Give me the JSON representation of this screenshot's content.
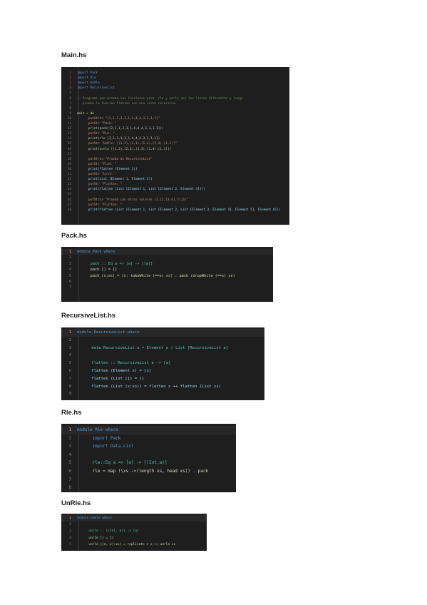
{
  "files": [
    {
      "label": "Main.hs",
      "lines": [
        {
          "n": "1",
          "t": "import Pack",
          "c": "kw"
        },
        {
          "n": "2",
          "t": "import Rle",
          "c": "kw"
        },
        {
          "n": "3",
          "t": "import UnRle",
          "c": "kw"
        },
        {
          "n": "4",
          "t": "import RecursiveList",
          "c": "kw"
        },
        {
          "n": "5",
          "t": "",
          "c": ""
        },
        {
          "n": "6",
          "t": "-- Programa que prueba los funciones pack, rle y unrle con los listas diferentes y luego",
          "c": "cm"
        },
        {
          "n": "7",
          "t": "   prueba la funcion flatten con una lista recursiva.",
          "c": "cm"
        },
        {
          "n": "8",
          "t": "",
          "c": ""
        },
        {
          "n": "9",
          "t": "main = do",
          "c": "fn"
        },
        {
          "n": "10",
          "t": "      putStrLn \"[2,1,1,3,3,1,4,4,4,3,3,1,1]\"",
          "c": "st"
        },
        {
          "n": "11",
          "t": "      putStr \"Pack: \"",
          "c": "st"
        },
        {
          "n": "12",
          "t": "      print(pack([2,1,1,3,3,1,4,4,4,3,3,1,1]))",
          "c": "nu"
        },
        {
          "n": "13",
          "t": "      putStr \"Rle: \"",
          "c": "st"
        },
        {
          "n": "14",
          "t": "      print(rle [2,1,1,3,3,1,4,4,4,3,3,1,1])",
          "c": "nu"
        },
        {
          "n": "15",
          "t": "      putStr \"UnRle: [(1,2),(2,1),(1,3),(2,4),(1,1)]\"",
          "c": "st"
        },
        {
          "n": "16",
          "t": "      print(unrle [(1,2),(2,1),(1,3),(2,4),(1,1)])",
          "c": "nu"
        },
        {
          "n": "17",
          "t": "",
          "c": ""
        },
        {
          "n": "18",
          "t": "      putStrLn \"Prueba de RecursiveList\"",
          "c": "st"
        },
        {
          "n": "19",
          "t": "      putStr \"Flat: \"",
          "c": "st"
        },
        {
          "n": "20",
          "t": "      print(flatten (Element 1))",
          "c": "vr"
        },
        {
          "n": "21",
          "t": "      putStr \"List: \"",
          "c": "st"
        },
        {
          "n": "22",
          "t": "      print(List [Element 1, Element 2])",
          "c": "vr"
        },
        {
          "n": "23",
          "t": "      putStr \"Flatten: \"",
          "c": "st"
        },
        {
          "n": "24",
          "t": "      print(flatten (List [Element 1, List [Element 2, Element 3]]))",
          "c": "vr"
        },
        {
          "n": "25",
          "t": "",
          "c": ""
        },
        {
          "n": "26",
          "t": "      putStrLn \"Prueba con otros valores [1,[2,[3,4],5],6]\"",
          "c": "st"
        },
        {
          "n": "27",
          "t": "      putStr \"Flatten: \"",
          "c": "st"
        },
        {
          "n": "28",
          "t": "      print(flatten (List [Element 1, List [Element 2, List [Element 3, Element 4], Element 5], Element 6]))",
          "c": "vr"
        }
      ]
    },
    {
      "label": "Pack.hs",
      "lines": [
        {
          "n": "1",
          "t": "module Pack where",
          "c": "kw"
        },
        {
          "n": "2",
          "t": "",
          "c": ""
        },
        {
          "n": "3",
          "t": "      pack :: Eq a => [a] -> [[a]]",
          "c": "ty"
        },
        {
          "n": "4",
          "t": "      pack [] = []",
          "c": "op"
        },
        {
          "n": "5",
          "t": "      pack (x:xs) = (x: takeWhile (==x) xs) : pack (dropWhile (==x) xs)",
          "c": "fn"
        },
        {
          "n": "6",
          "t": "",
          "c": ""
        },
        {
          "n": "7",
          "t": "",
          "c": ""
        }
      ]
    },
    {
      "label": "RecursiveList.hs",
      "lines": [
        {
          "n": "1",
          "t": "module RecursiveList where",
          "c": "kw"
        },
        {
          "n": "2",
          "t": "",
          "c": ""
        },
        {
          "n": "3",
          "t": "      data RecursiveList a = Element a | List [RecursiveList a]",
          "c": "ty"
        },
        {
          "n": "4",
          "t": "",
          "c": ""
        },
        {
          "n": "5",
          "t": "      flatten :: RecursiveList a -> [a]",
          "c": "ty"
        },
        {
          "n": "6",
          "t": "      flatten (Element x) = [x]",
          "c": "vr"
        },
        {
          "n": "7",
          "t": "      flatten (List []) = []",
          "c": "vr"
        },
        {
          "n": "8",
          "t": "      flatten (List (x:xs)) = flatten x ++ flatten (List xs)",
          "c": "vr"
        },
        {
          "n": "9",
          "t": "",
          "c": ""
        }
      ]
    },
    {
      "label": "Rle.hs",
      "lines": [
        {
          "n": "1",
          "t": "module Rle where",
          "c": "kw"
        },
        {
          "n": "2",
          "t": "      import Pack",
          "c": "kw"
        },
        {
          "n": "3",
          "t": "      import Data.List",
          "c": "kw"
        },
        {
          "n": "4",
          "t": "",
          "c": ""
        },
        {
          "n": "5",
          "t": "      rle::Eq a => [a] -> [(Int,a)]",
          "c": "ty"
        },
        {
          "n": "6",
          "t": "      rle = map (\\xs ->(length xs, head xs)) . pack",
          "c": "fn"
        },
        {
          "n": "7",
          "t": "",
          "c": ""
        },
        {
          "n": "8",
          "t": "",
          "c": ""
        }
      ]
    },
    {
      "label": "UnRle.hs",
      "lines": [
        {
          "n": "1",
          "t": "module UnRle where",
          "c": "kw"
        },
        {
          "n": "2",
          "t": "",
          "c": ""
        },
        {
          "n": "3",
          "t": "      unrle :: [(Int, a)] -> [a]",
          "c": "ty"
        },
        {
          "n": "4",
          "t": "      unrle [] = []",
          "c": "fn"
        },
        {
          "n": "5",
          "t": "      unrle ((n, x):xs) = replicate n x ++ unrle xs",
          "c": "fn"
        }
      ]
    }
  ]
}
